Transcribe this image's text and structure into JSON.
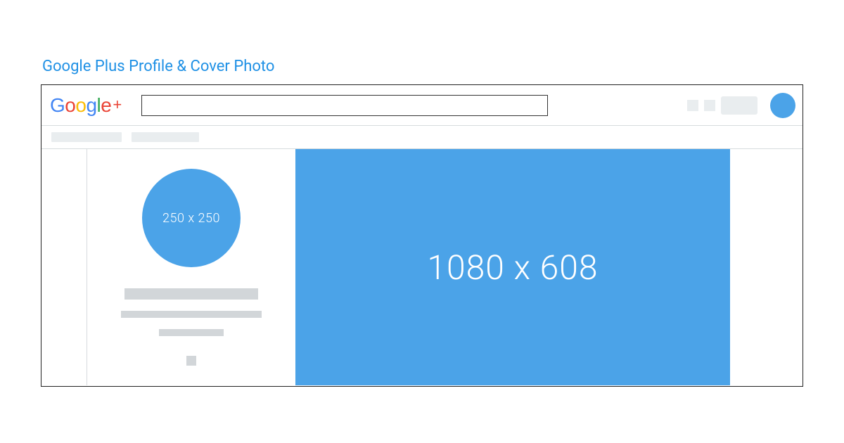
{
  "page": {
    "title": "Google Plus Profile & Cover Photo"
  },
  "logo": {
    "text": "Google",
    "suffix": "+"
  },
  "dimensions": {
    "profile": "250 x 250",
    "cover": "1080 x 608"
  },
  "colors": {
    "accent": "#4ba3e8",
    "title": "#1e90e5",
    "placeholder": "#d2d6d9",
    "placeholder_light": "#e9edef"
  }
}
